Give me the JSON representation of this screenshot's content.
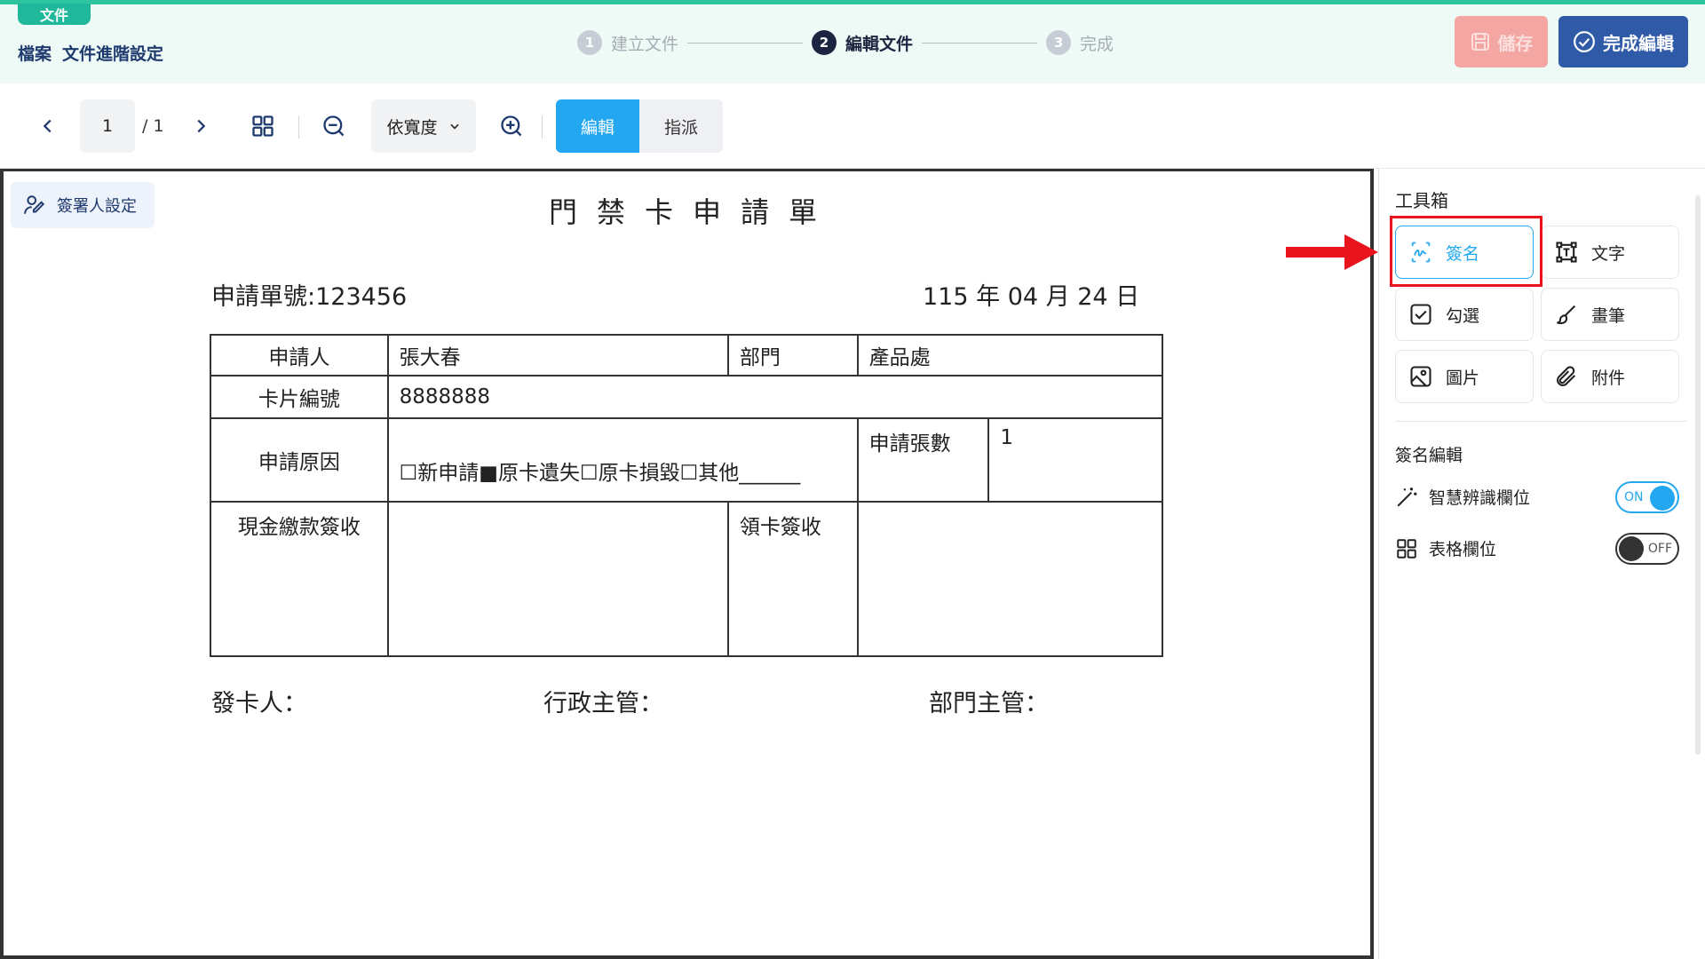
{
  "header": {
    "file_tag": "文件",
    "breadcrumb": [
      "檔案",
      "文件進階設定"
    ],
    "steps": [
      {
        "num": "1",
        "label": "建立文件"
      },
      {
        "num": "2",
        "label": "編輯文件"
      },
      {
        "num": "3",
        "label": "完成"
      }
    ],
    "save_label": "儲存",
    "done_label": "完成編輯"
  },
  "toolbar": {
    "page_current": "1",
    "page_total": "/ 1",
    "zoom_mode": "依寬度",
    "mode_edit": "編輯",
    "mode_assign": "指派"
  },
  "document": {
    "signer_button": "簽署人設定",
    "title": "門禁卡申請單",
    "form_no": "申請單號:123456",
    "date": "115 年 04 月 24 日",
    "table": {
      "applicant_label": "申請人",
      "applicant_value": "張大春",
      "dept_label": "部門",
      "dept_value": "產品處",
      "card_no_label": "卡片編號",
      "card_no_value": "8888888",
      "reason_label": "申請原因",
      "reason_value": "☐新申請■原卡遺失☐原卡損毀☐其他______",
      "count_label": "申請張數",
      "count_value": "1",
      "cash_label": "現金繳款簽收",
      "receive_label": "領卡簽收"
    },
    "footer": {
      "issuer": "發卡人：",
      "admin_supervisor": "行政主管：",
      "dept_supervisor": "部門主管："
    }
  },
  "sidebar": {
    "toolbox_title": "工具箱",
    "tools": {
      "signature": "簽名",
      "text": "文字",
      "checkbox": "勾選",
      "pen": "畫筆",
      "image": "圖片",
      "attachment": "附件"
    },
    "sign_edit_title": "簽名編輯",
    "smart_detect_label": "智慧辨識欄位",
    "smart_detect_state": "ON",
    "table_field_label": "表格欄位",
    "table_field_state": "OFF"
  },
  "colors": {
    "accent": "#22a7f0",
    "primary": "#2f5aa8",
    "highlight": "#e8131c",
    "header_bg": "#eefaf6"
  }
}
